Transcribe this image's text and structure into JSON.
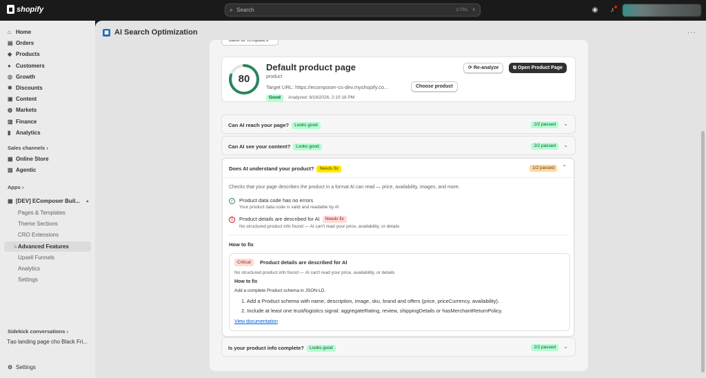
{
  "topbar": {
    "brand": "shopify",
    "search_placeholder": "Search",
    "shortcut_ctrl": "CTRL",
    "shortcut_key": "K"
  },
  "sidebar": {
    "items": [
      {
        "label": "Home",
        "icon": "home-icon",
        "glyph": "⌂"
      },
      {
        "label": "Orders",
        "icon": "inbox-icon",
        "glyph": "▤"
      },
      {
        "label": "Products",
        "icon": "tag-icon",
        "glyph": "◆"
      },
      {
        "label": "Customers",
        "icon": "person-icon",
        "glyph": "●"
      },
      {
        "label": "Growth",
        "icon": "target-icon",
        "glyph": "◎"
      },
      {
        "label": "Discounts",
        "icon": "discount-icon",
        "glyph": "✱"
      },
      {
        "label": "Content",
        "icon": "content-icon",
        "glyph": "▣"
      },
      {
        "label": "Markets",
        "icon": "globe-icon",
        "glyph": "◍"
      },
      {
        "label": "Finance",
        "icon": "bank-icon",
        "glyph": "▥"
      },
      {
        "label": "Analytics",
        "icon": "bar-chart-icon",
        "glyph": "▮"
      }
    ],
    "sales_channels_label": "Sales channels",
    "channels": [
      {
        "label": "Online Store",
        "icon": "store-icon",
        "glyph": "▦"
      },
      {
        "label": "Agentic",
        "icon": "agentic-icon",
        "glyph": "▧"
      }
    ],
    "apps_label": "Apps",
    "app_name": "[DEV] EComposer Buil...",
    "app_subitems": [
      {
        "label": "Pages & Templates",
        "active": false
      },
      {
        "label": "Theme Sections",
        "active": false
      },
      {
        "label": "CRO Extensions",
        "active": false
      },
      {
        "label": "Advanced Features",
        "active": true
      },
      {
        "label": "Upsell Funnels",
        "active": false
      },
      {
        "label": "Analytics",
        "active": false
      },
      {
        "label": "Settings",
        "active": false
      }
    ],
    "sidekick_label": "Sidekick conversations",
    "sidekick_item": "Tạo landing page cho Black Fri...",
    "settings_label": "Settings"
  },
  "page": {
    "title": "AI Search Optimization",
    "back_label": "Back to Templates"
  },
  "summary": {
    "score": "80",
    "score_value": 80,
    "title": "Default product page",
    "type": "product",
    "target_url": "Target URL: https://ecomposer-cs-dev.myshopify.co...",
    "choose_btn": "Choose product",
    "status": "Good",
    "analyzed": "Analyzed: 8/16/2026, 2:10:18 PM",
    "reanalyze_btn": "Re-analyze",
    "open_btn": "Open Product Page",
    "accent_color": "#29845a"
  },
  "checks": [
    {
      "title": "Can AI reach your page?",
      "badge": "Looks good",
      "passed": "2/2 passed"
    },
    {
      "title": "Can AI see your content?",
      "badge": "Looks good",
      "passed": "2/2 passed"
    },
    {
      "title": "Does AI understand your product?",
      "badge": "Needs fix",
      "passed": "1/2 passed"
    },
    {
      "title": "Is your product info complete?",
      "badge": "Looks good",
      "passed": "2/2 passed"
    }
  ],
  "expanded": {
    "description": "Checks that your page describes the product in a format AI can read — price, availability, images, and more.",
    "items": [
      {
        "title": "Product data code has no errors",
        "subtitle": "Your product data code is valid and readable by AI"
      },
      {
        "title": "Product details are described for AI",
        "badge": "Needs fix",
        "subtitle": "No structured product info found — AI can't read your price, availability, or details"
      }
    ],
    "how_to_fix": "How to fix",
    "fix": {
      "severity": "Critical",
      "title": "Product details are described for AI",
      "subtitle": "No structured product info found — AI can't read your price, availability, or details",
      "how_to_label": "How to fix",
      "add_line": "Add a complete Product schema in JSON-LD.",
      "steps": [
        "1. Add a Product schema with name, description, image, sku, brand and offers (price, priceCurrency, availability).",
        "2. Include at least one trust/logistics signal: aggregateRating, review, shippingDetails or hasMerchantReturnPolicy."
      ],
      "link": "View documentation"
    }
  }
}
